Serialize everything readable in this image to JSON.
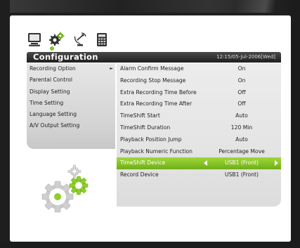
{
  "header": {
    "title": "Configuration",
    "clock": "12:15/05-Jul-2006[Wed]"
  },
  "top_icons": [
    {
      "name": "monitor-icon"
    },
    {
      "name": "gears-icon",
      "selected": true
    },
    {
      "name": "satellite-dish-icon"
    },
    {
      "name": "calculator-icon"
    }
  ],
  "left_menu": {
    "items": [
      {
        "label": "Recording Option",
        "active": true
      },
      {
        "label": "Parental Control"
      },
      {
        "label": "Display Setting"
      },
      {
        "label": "Time Setting"
      },
      {
        "label": "Language Setting"
      },
      {
        "label": "A/V Output Setting"
      }
    ]
  },
  "settings": {
    "rows": [
      {
        "label": "Alarm Confirm Message",
        "value": "On"
      },
      {
        "label": "Recording Stop Message",
        "value": "On"
      },
      {
        "label": "Extra Recording Time Before",
        "value": "Off"
      },
      {
        "label": "Extra Recording Time After",
        "value": "Off"
      },
      {
        "label": "TimeShift Start",
        "value": "Auto"
      },
      {
        "label": "TimeShift Duration",
        "value": "120 Min"
      },
      {
        "label": "Playback Position Jump",
        "value": "Auto"
      },
      {
        "label": "Playback Numeric Function",
        "value": "Percentage Move"
      },
      {
        "label": "TimeShift Device",
        "value": "USB1 (Front)",
        "selected": true
      },
      {
        "label": "Record Device",
        "value": "USB1 (Front)"
      }
    ]
  },
  "colors": {
    "accent": "#7ec72b",
    "title_bar": "#2a2a2a",
    "panel": "#e6e6e6"
  }
}
